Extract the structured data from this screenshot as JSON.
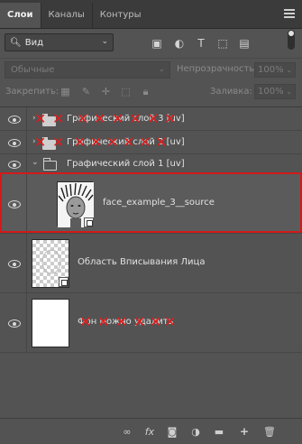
{
  "tabs": [
    {
      "label": "Слои",
      "active": true
    },
    {
      "label": "Каналы",
      "active": false
    },
    {
      "label": "Контуры",
      "active": false
    }
  ],
  "filter": {
    "kind_label": "Вид"
  },
  "blend": {
    "mode": "Обычные",
    "opacity_label": "Непрозрачность:",
    "opacity_value": "100%"
  },
  "lock": {
    "label": "Закрепить:",
    "fill_label": "Заливка:",
    "fill_value": "100%"
  },
  "layers": [
    {
      "name": "Графический слой 3 [uv]",
      "type": "group",
      "visible": true,
      "collapsed": true,
      "obscured": true
    },
    {
      "name": "Графический слой 2 [uv]",
      "type": "group",
      "visible": true,
      "collapsed": true,
      "obscured": true
    },
    {
      "name": "Графический слой 1 [uv]",
      "type": "group",
      "visible": true,
      "collapsed": false,
      "obscured": false
    },
    {
      "name": "face_example_3__source",
      "type": "smart-object",
      "visible": true,
      "selected": true
    },
    {
      "name": "Область Вписывания Лица",
      "type": "smart-object",
      "visible": true
    },
    {
      "name": "Фон можно удалить",
      "type": "pixel",
      "visible": true,
      "obscured": true
    }
  ],
  "colors": {
    "selection_outline": "#d11a1a",
    "cross_marks": "#e21c1c",
    "panel_bg": "#535353"
  }
}
